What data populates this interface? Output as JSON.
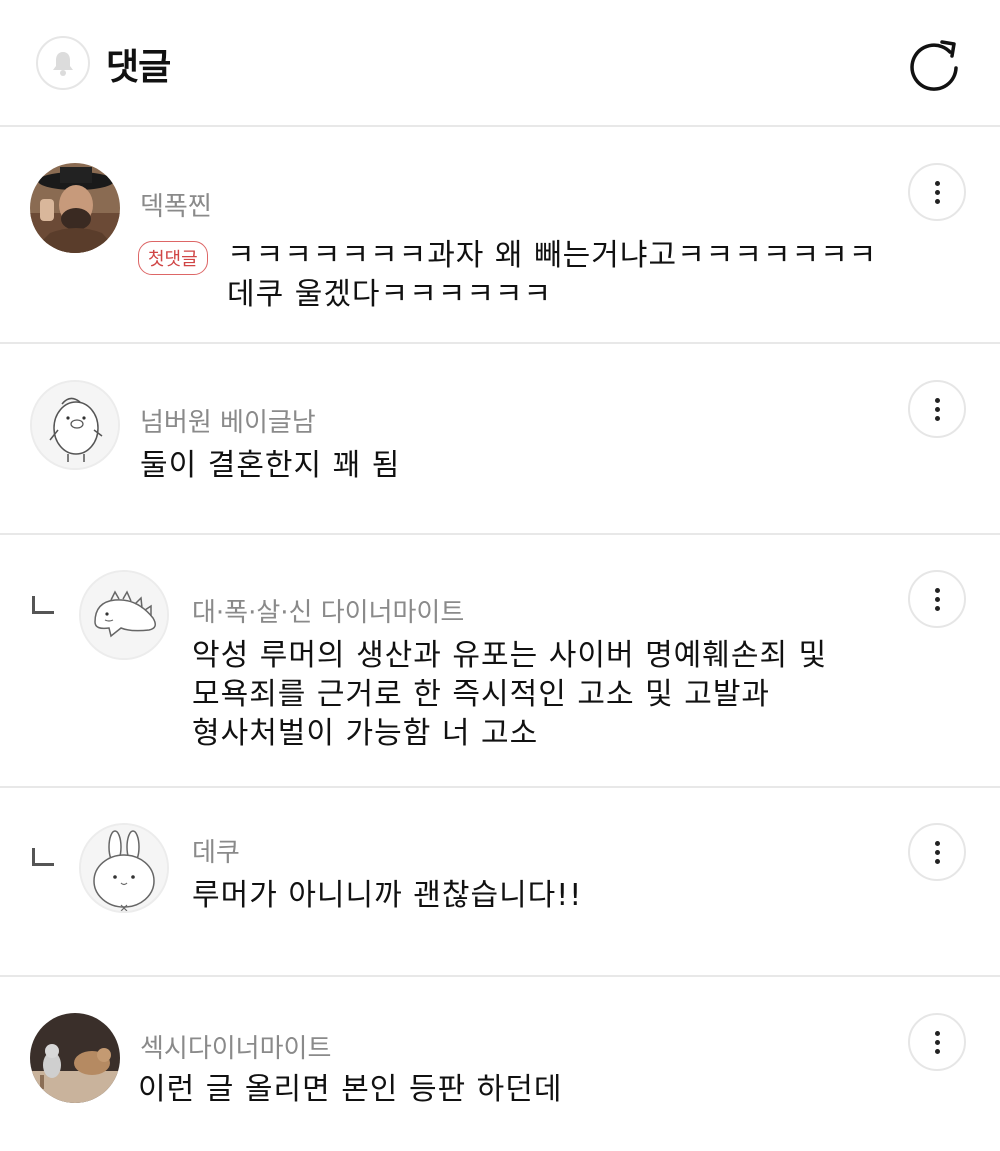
{
  "header": {
    "title": "댓글",
    "bell_icon": "bell-icon",
    "refresh_icon": "refresh-icon"
  },
  "comments": [
    {
      "nickname": "덱폭찐",
      "badge": "첫댓글",
      "text": "ㅋㅋㅋㅋㅋㅋㅋ과자 왜 빼는거냐고ㅋㅋㅋㅋㅋㅋㅋ\n데쿠 울겠다ㅋㅋㅋㅋㅋㅋ",
      "is_reply": false
    },
    {
      "nickname": "넘버원 베이글남",
      "text": "둘이 결혼한지 꽤 됨",
      "is_reply": false
    },
    {
      "nickname": "대·폭·살·신 다이너마이트",
      "text": "악성 루머의 생산과 유포는 사이버 명예훼손죄 및\n모욕죄를 근거로 한 즉시적인 고소 및 고발과\n형사처벌이 가능함 너 고소",
      "is_reply": true
    },
    {
      "nickname": "데쿠",
      "text": "루머가 아니니까 괜찮습니다!!",
      "is_reply": true
    },
    {
      "nickname": "섹시다이너마이트",
      "text": "이런 글 올리면 본인 등판 하던데",
      "is_reply": false
    }
  ],
  "colors": {
    "divider": "#e8e8e8",
    "nickname": "#8a8a8a",
    "badge": "#d04545"
  }
}
